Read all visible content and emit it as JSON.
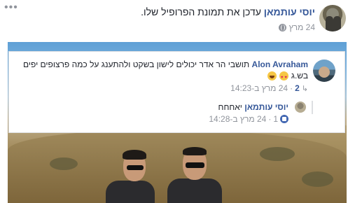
{
  "post": {
    "author": "יוסי עותמאן",
    "action": "עדכן את תמונת הפרופיל שלו.",
    "date": "24 מרץ",
    "more_label": "•••"
  },
  "comments": [
    {
      "author": "Alon Avraham",
      "text": "תושבי הר אדר יכולים לישון בשקט ולהתענג על כמה פרצופים יפים",
      "text_cont": "בש.ג",
      "emojis": [
        "heart-eyes-emoji",
        "laughing-emoji"
      ],
      "reply_count": "2",
      "timestamp": "24 מרץ ב-14:23"
    }
  ],
  "reply": {
    "author": "יוסי עותמאן",
    "text": "יאחחח",
    "like_count": "1",
    "timestamp": "24 מרץ ב-14:28"
  },
  "icons": {
    "globe": "globe-icon",
    "reply_arrow": "reply-arrow-icon",
    "like": "like-icon"
  },
  "colors": {
    "link": "#365899",
    "meta": "#90949c",
    "border": "#dddfe2",
    "like_blue": "#4267b2"
  }
}
